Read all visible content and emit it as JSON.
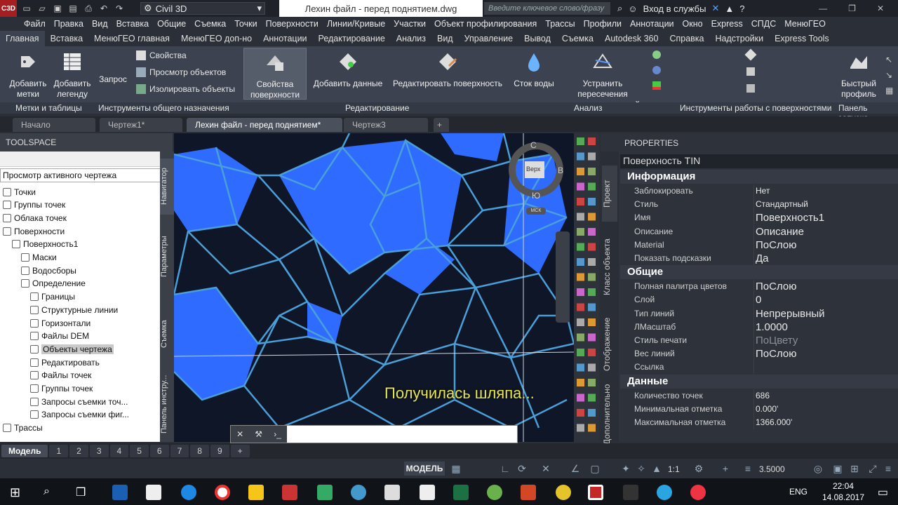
{
  "titlebar": {
    "app_icon": "C3D",
    "workspace": "Civil 3D",
    "document_title": "Лехин файл - перед поднятием.dwg",
    "search_placeholder": "Введите ключевое слово/фразу",
    "signin": "Вход в службы",
    "quick_access_icons": [
      "new-icon",
      "open-icon",
      "save-icon",
      "save-as-icon",
      "print-icon",
      "undo-icon",
      "redo-icon"
    ]
  },
  "menu": [
    "Файл",
    "Правка",
    "Вид",
    "Вставка",
    "Общие",
    "Съемка",
    "Точки",
    "Поверхности",
    "Линии/Кривые",
    "Участки",
    "Объект профилирования",
    "Трассы",
    "Профили",
    "Аннотации",
    "Окно",
    "Express",
    "СПДС",
    "МенюГЕО"
  ],
  "ribbon_tabs": [
    "Главная",
    "Вставка",
    "МенюГЕО главная",
    "МенюГЕО доп-но",
    "Аннотации",
    "Редактирование",
    "Анализ",
    "Вид",
    "Управление",
    "Вывод",
    "Съемка",
    "Autodesk 360",
    "Справка",
    "Надстройки",
    "Express Tools"
  ],
  "ribbon": {
    "buttons": {
      "add_labels": "Добавить метки",
      "add_legend": "Добавить легенду",
      "query": "Запрос",
      "properties": "Свойства",
      "object_viewer": "Просмотр объектов",
      "isolate": "Изолировать объекты",
      "surface_props": "Свойства поверхности",
      "add_data": "Добавить данные",
      "edit_surface": "Редактировать поверхность",
      "water_drop": "Сток воды",
      "fix_crossings": "Устранить пересечения структурных линий",
      "quick_profile": "Быстрый профиль"
    },
    "panels": {
      "labels_tables": "Метки и таблицы",
      "general_tools": "Инструменты общего назначения",
      "modify": "Редактирование",
      "analyze": "Анализ",
      "surface_tools": "Инструменты работы с поверхностями",
      "launch": "Панель запуска"
    }
  },
  "doc_tabs": [
    "Начало",
    "Чертеж1*",
    "Лехин файл - перед поднятием*",
    "Чертеж3"
  ],
  "toolspace": {
    "title": "TOOLSPACE",
    "view_select": "Просмотр активного чертежа",
    "tree": [
      {
        "label": "Точки",
        "icon": "points-icon",
        "indent": 1
      },
      {
        "label": "Группы точек",
        "icon": "point-groups-icon",
        "indent": 1
      },
      {
        "label": "Облака точек",
        "icon": "point-clouds-icon",
        "indent": 1
      },
      {
        "label": "Поверхности",
        "icon": "surfaces-icon",
        "indent": 1
      },
      {
        "label": "Поверхность1",
        "icon": "surface-icon",
        "indent": 2
      },
      {
        "label": "Маски",
        "icon": "masks-icon",
        "indent": 3
      },
      {
        "label": "Водосборы",
        "icon": "watersheds-icon",
        "indent": 3
      },
      {
        "label": "Определение",
        "icon": "definition-icon",
        "indent": 3
      },
      {
        "label": "Границы",
        "icon": "boundaries-icon",
        "indent": 4
      },
      {
        "label": "Структурные линии",
        "icon": "breaklines-icon",
        "indent": 4
      },
      {
        "label": "Горизонтали",
        "icon": "contours-icon",
        "indent": 4
      },
      {
        "label": "Файлы DEM",
        "icon": "dem-files-icon",
        "indent": 4
      },
      {
        "label": "Объекты чертежа",
        "icon": "drawing-objects-icon",
        "indent": 4,
        "selected": true
      },
      {
        "label": "Редактировать",
        "icon": "edits-icon",
        "indent": 4
      },
      {
        "label": "Файлы точек",
        "icon": "point-files-icon",
        "indent": 4
      },
      {
        "label": "Группы точек",
        "icon": "point-groups-icon",
        "indent": 4
      },
      {
        "label": "Запросы съемки точ...",
        "icon": "survey-queries-icon",
        "indent": 4
      },
      {
        "label": "Запросы съемки фиг...",
        "icon": "survey-figure-queries-icon",
        "indent": 4
      },
      {
        "label": "Трассы",
        "icon": "alignments-icon",
        "indent": 1
      }
    ],
    "vtabs": [
      "Навигатор",
      "Параметры",
      "Съемка",
      "Панель инстру..."
    ]
  },
  "viewport": {
    "caption": "Получилась шляпа...",
    "viewcube": {
      "top": "Верх",
      "north": "С",
      "south": "Ю",
      "east": "В",
      "ucs": "МСК"
    }
  },
  "properties": {
    "title": "PROPERTIES",
    "selection": "Поверхность TIN",
    "vtabs": [
      "Проект",
      "Класс объекта",
      "Отображение",
      "Дополнительно"
    ],
    "sections": [
      {
        "name": "Информация",
        "rows": [
          {
            "k": "Заблокировать",
            "v": "Нет"
          },
          {
            "k": "Стиль",
            "v": "Стандартный"
          },
          {
            "k": "Имя",
            "v": "Поверхность1",
            "big": true
          },
          {
            "k": "Описание",
            "v": "Описание",
            "big": true
          },
          {
            "k": "Material",
            "v": "ПоСлою",
            "big": true
          },
          {
            "k": "Показать подсказки",
            "v": "Да",
            "big": true
          }
        ]
      },
      {
        "name": "Общие",
        "rows": [
          {
            "k": "Полная палитра цветов",
            "v": "ПоСлою",
            "big": true
          },
          {
            "k": "Слой",
            "v": "0",
            "big": true
          },
          {
            "k": "Тип линий",
            "v": "Непрерывный",
            "big": true
          },
          {
            "k": "ЛМасштаб",
            "v": "1.0000",
            "big": true
          },
          {
            "k": "Стиль печати",
            "v": "ПоЦвету",
            "dim": true
          },
          {
            "k": "Вес линий",
            "v": "ПоСлою",
            "big": true
          },
          {
            "k": "Ссылка",
            "v": ""
          }
        ]
      },
      {
        "name": "Данные",
        "rows": [
          {
            "k": "Количество точек",
            "v": "686"
          },
          {
            "k": "Минимальная отметка",
            "v": "0.000'"
          },
          {
            "k": "Максимальная отметка",
            "v": "1366.000'"
          }
        ]
      }
    ]
  },
  "model_tabs": [
    "Модель",
    "1",
    "2",
    "3",
    "4",
    "5",
    "6",
    "7",
    "8",
    "9"
  ],
  "status": {
    "model": "МОДЕЛЬ",
    "scale": "1:1",
    "lineweight": "3.5000"
  },
  "taskbar": {
    "lang": "ENG",
    "time": "22:04",
    "date": "14.08.2017"
  },
  "colors": {
    "surface_blue": "#2f6bff",
    "tin_lines": "#4a9fd8",
    "bg": "#0e1628",
    "accent_red": "#a61e22",
    "caption": "#e6e651"
  }
}
